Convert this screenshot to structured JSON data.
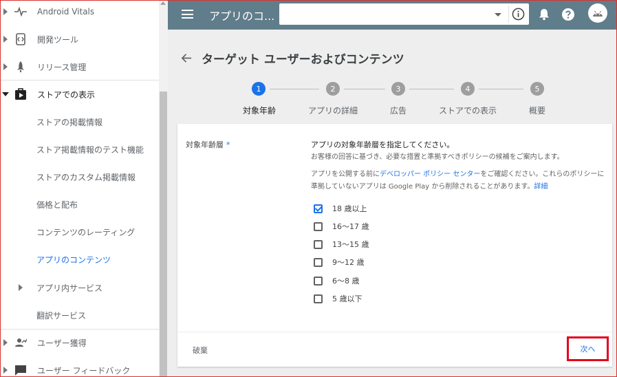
{
  "sidebar": {
    "items": [
      {
        "label": "Android Vitals",
        "icon": "pulse-icon"
      },
      {
        "label": "開発ツール",
        "icon": "code-icon"
      },
      {
        "label": "リリース管理",
        "icon": "rocket-icon"
      },
      {
        "label": "ストアでの表示",
        "icon": "store-play-icon"
      },
      {
        "label": "ストアの掲載情報"
      },
      {
        "label": "ストア掲載情報のテスト機能"
      },
      {
        "label": "ストアのカスタム掲載情報"
      },
      {
        "label": "価格と配布"
      },
      {
        "label": "コンテンツのレーティング"
      },
      {
        "label": "アプリのコンテンツ"
      },
      {
        "label": "アプリ内サービス"
      },
      {
        "label": "翻訳サービス"
      },
      {
        "label": "ユーザー獲得",
        "icon": "acquisition-icon"
      },
      {
        "label": "ユーザー フィードバック",
        "icon": "feedback-icon"
      }
    ]
  },
  "topbar": {
    "app_title": "アプリのコ...",
    "app_selector_value": ""
  },
  "page": {
    "title": "ターゲット ユーザーおよびコンテンツ"
  },
  "stepper": {
    "steps": [
      {
        "number": "1",
        "label": "対象年齢",
        "active": true
      },
      {
        "number": "2",
        "label": "アプリの詳細"
      },
      {
        "number": "3",
        "label": "広告"
      },
      {
        "number": "4",
        "label": "ストアでの表示"
      },
      {
        "number": "5",
        "label": "概要"
      }
    ]
  },
  "form": {
    "field_label": "対象年齢層",
    "required_mark": "*",
    "intro": "アプリの対象年齢層を指定してください。",
    "sub": "お客様の回答に基づき、必要な措置と準拠すべきポリシーの候補をご案内します。",
    "policy_prefix": "アプリを公開する前に",
    "policy_link": "デベロッパー ポリシー センター",
    "policy_suffix": "をご確認ください。これらのポリシーに",
    "policy_line2": "準拠していないアプリは Google Play から削除されることがあります。",
    "learn_more": "詳細",
    "options": [
      {
        "label": "18 歳以上",
        "checked": true
      },
      {
        "label": "16〜17 歳",
        "checked": false
      },
      {
        "label": "13〜15 歳",
        "checked": false
      },
      {
        "label": "9〜12 歳",
        "checked": false
      },
      {
        "label": "6〜8 歳",
        "checked": false
      },
      {
        "label": "5 歳以下",
        "checked": false
      }
    ],
    "discard_label": "破棄",
    "next_label": "次へ"
  },
  "colors": {
    "topbar": "#607d8b",
    "accent": "#1a73e8",
    "highlight_border": "#e3001b"
  }
}
